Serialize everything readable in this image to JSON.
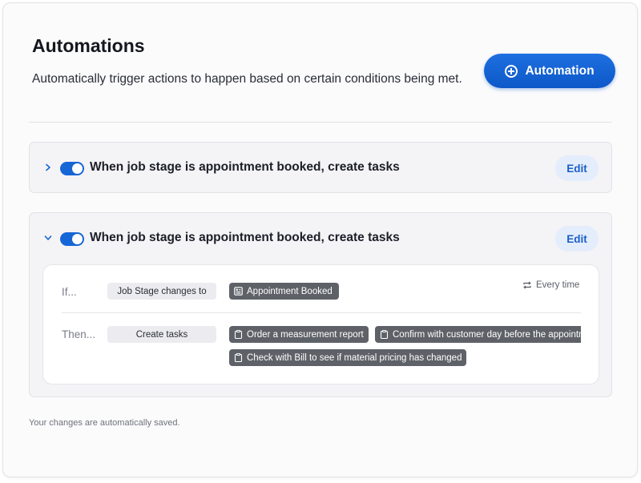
{
  "header": {
    "title": "Automations",
    "subtitle": "Automatically trigger actions to happen based on certain conditions being met.",
    "add_button_label": "Automation"
  },
  "automations": [
    {
      "title": "When job stage is appointment booked, create tasks",
      "enabled": true,
      "expanded": false,
      "edit_label": "Edit"
    },
    {
      "title": "When job stage is appointment booked, create tasks",
      "enabled": true,
      "expanded": true,
      "edit_label": "Edit",
      "condition": {
        "if_label": "If...",
        "trigger": "Job Stage changes to",
        "value": "Appointment Booked",
        "frequency": "Every time"
      },
      "action": {
        "then_label": "Then...",
        "type": "Create tasks",
        "tasks": [
          "Order a measurement report",
          "Confirm with customer day before the appointment",
          "Check with Bill to see if material pricing has changed"
        ]
      }
    }
  ],
  "footer": {
    "note": "Your changes are automatically saved."
  },
  "colors": {
    "accent": "#1766d6",
    "chip_dark": "#5e6268",
    "edit_bg": "#e4edfb"
  }
}
